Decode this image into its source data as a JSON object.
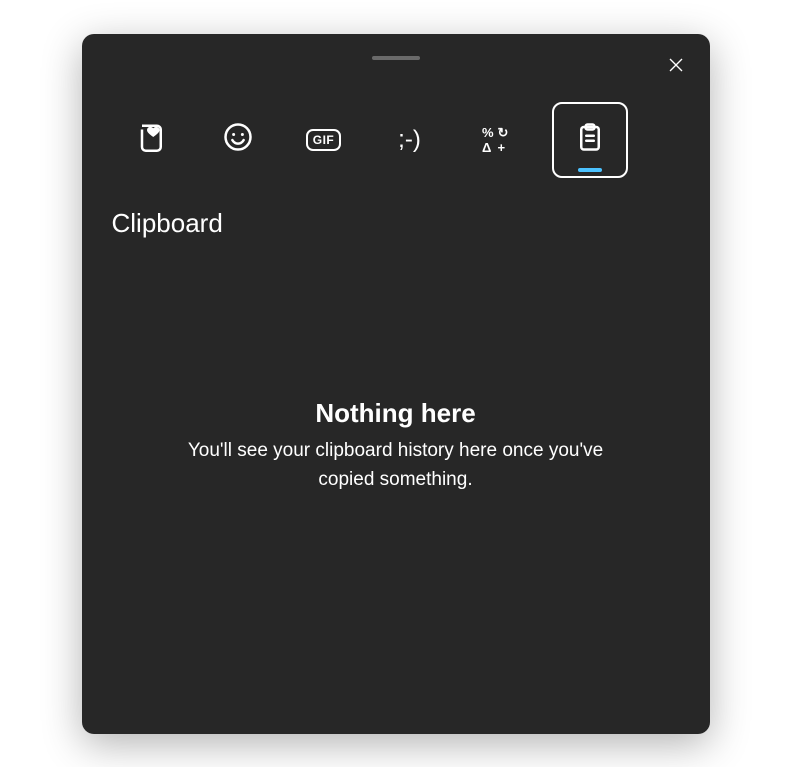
{
  "section_title": "Clipboard",
  "tabs": {
    "recent": {
      "name": "recent-tab"
    },
    "emoji": {
      "name": "emoji-tab"
    },
    "gif": {
      "name": "gif-tab",
      "label": "GIF"
    },
    "kaomoji": {
      "name": "kaomoji-tab",
      "label": ";-)"
    },
    "symbols": {
      "name": "symbols-tab",
      "tl": "%",
      "tr": "↻",
      "bl": "Δ",
      "br": "+"
    },
    "clipboard": {
      "name": "clipboard-tab",
      "selected": true
    }
  },
  "empty_state": {
    "title": "Nothing here",
    "description": "You'll see your clipboard history here once you've copied something."
  },
  "colors": {
    "panel_bg": "#272727",
    "accent": "#4cc2ff",
    "text": "#ffffff"
  }
}
